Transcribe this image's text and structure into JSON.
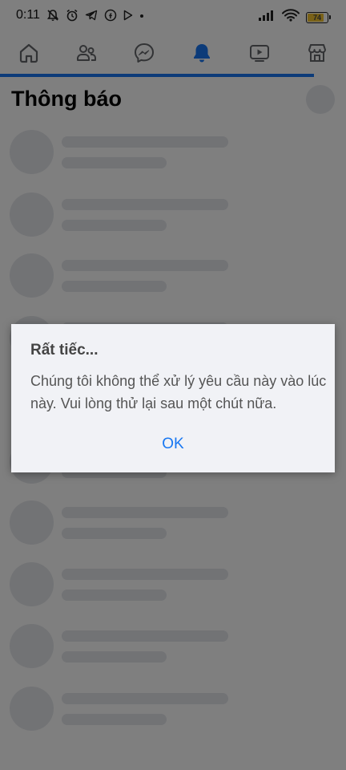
{
  "status_bar": {
    "time": "0:11",
    "battery_level": "74"
  },
  "nav": {
    "tabs": [
      {
        "name": "home",
        "icon": "home-icon"
      },
      {
        "name": "friends",
        "icon": "friends-icon"
      },
      {
        "name": "messenger",
        "icon": "messenger-icon"
      },
      {
        "name": "notifications",
        "icon": "bell-icon",
        "active": true
      },
      {
        "name": "watch",
        "icon": "video-icon"
      },
      {
        "name": "marketplace",
        "icon": "marketplace-icon"
      }
    ],
    "active_color": "#1877f2",
    "inactive_color": "#65676b"
  },
  "page": {
    "title": "Thông báo"
  },
  "dialog": {
    "title": "Rất tiếc...",
    "message": "Chúng tôi không thể xử lý yêu cầu này vào lúc này. Vui lòng thử lại sau một chút nữa.",
    "ok_label": "OK"
  },
  "colors": {
    "accent": "#1877f2",
    "skeleton": "#e4e6eb"
  }
}
